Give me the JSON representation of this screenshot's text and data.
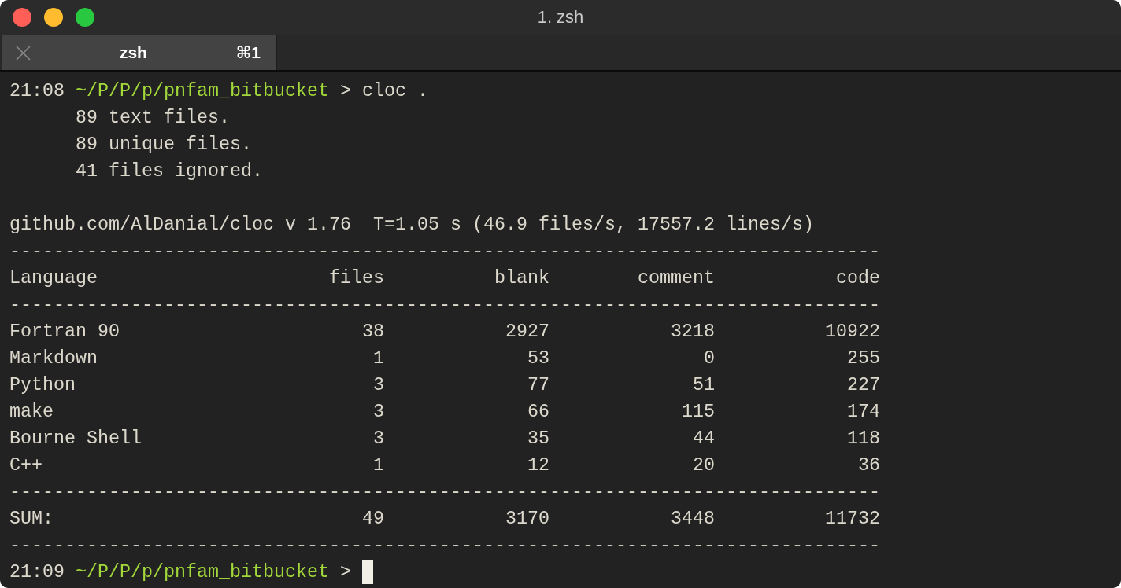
{
  "window": {
    "title": "1. zsh"
  },
  "tabs": [
    {
      "label": "zsh",
      "shortcut": "⌘1",
      "selected": true
    }
  ],
  "terminal": {
    "lines": [
      {
        "kind": "prompt",
        "time": "21:08",
        "path": "~/P/P/p/pnfam_bitbucket",
        "symbol": ">",
        "command": "cloc .",
        "cursor": false
      },
      {
        "kind": "note",
        "text": "89 text files."
      },
      {
        "kind": "note",
        "text": "89 unique files."
      },
      {
        "kind": "note",
        "text": "41 files ignored."
      },
      {
        "kind": "blank"
      },
      {
        "kind": "output",
        "text": "github.com/AlDanial/cloc v 1.76  T=1.05 s (46.9 files/s, 17557.2 lines/s)"
      },
      {
        "kind": "rule",
        "text": "-------------------------------------------------------------------------------"
      },
      {
        "kind": "header",
        "cells": [
          "Language",
          "files",
          "blank",
          "comment",
          "code"
        ]
      },
      {
        "kind": "rule",
        "text": "-------------------------------------------------------------------------------"
      },
      {
        "kind": "row",
        "cells": [
          "Fortran 90",
          "38",
          "2927",
          "3218",
          "10922"
        ]
      },
      {
        "kind": "row",
        "cells": [
          "Markdown",
          "1",
          "53",
          "0",
          "255"
        ]
      },
      {
        "kind": "row",
        "cells": [
          "Python",
          "3",
          "77",
          "51",
          "227"
        ]
      },
      {
        "kind": "row",
        "cells": [
          "make",
          "3",
          "66",
          "115",
          "174"
        ]
      },
      {
        "kind": "row",
        "cells": [
          "Bourne Shell",
          "3",
          "35",
          "44",
          "118"
        ]
      },
      {
        "kind": "row",
        "cells": [
          "C++",
          "1",
          "12",
          "20",
          "36"
        ]
      },
      {
        "kind": "rule",
        "text": "-------------------------------------------------------------------------------"
      },
      {
        "kind": "row",
        "cells": [
          "SUM:",
          "49",
          "3170",
          "3448",
          "11732"
        ]
      },
      {
        "kind": "rule",
        "text": "-------------------------------------------------------------------------------"
      },
      {
        "kind": "prompt",
        "time": "21:09",
        "path": "~/P/P/p/pnfam_bitbucket",
        "symbol": ">",
        "cursor": true
      }
    ]
  }
}
